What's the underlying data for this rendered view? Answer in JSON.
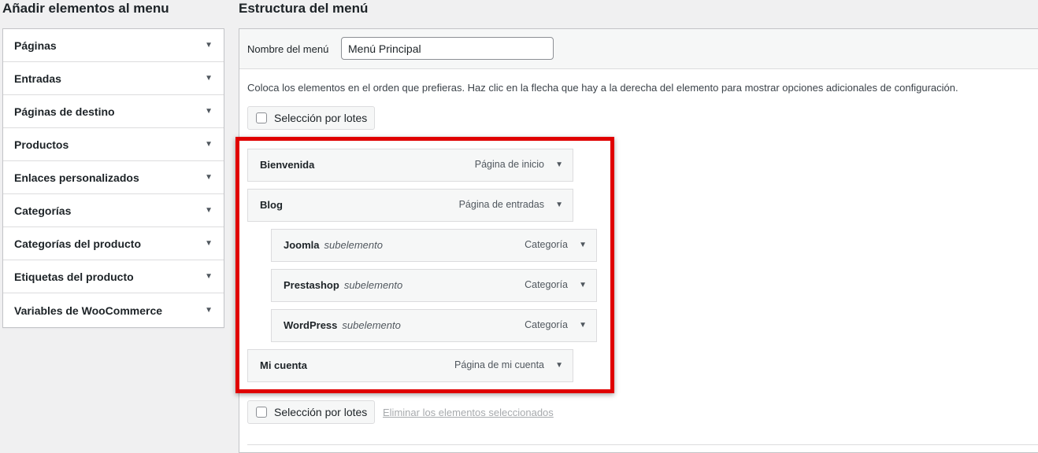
{
  "left_panel": {
    "title": "Añadir elementos al menu",
    "sections": [
      {
        "label": "Páginas"
      },
      {
        "label": "Entradas"
      },
      {
        "label": "Páginas de destino"
      },
      {
        "label": "Productos"
      },
      {
        "label": "Enlaces personalizados"
      },
      {
        "label": "Categorías"
      },
      {
        "label": "Categorías del producto"
      },
      {
        "label": "Etiquetas del producto"
      },
      {
        "label": "Variables de WooCommerce"
      }
    ]
  },
  "menu_structure": {
    "title": "Estructura del menú",
    "name_label": "Nombre del menú",
    "name_value": "Menú Principal",
    "instructions": "Coloca los elementos en el orden que prefieras. Haz clic en la flecha que hay a la derecha del elemento para mostrar opciones adicionales de configuración.",
    "bulk_select_label": "Selección por lotes",
    "delete_selected_label": "Eliminar los elementos seleccionados",
    "items": [
      {
        "title": "Bienvenida",
        "sub": "",
        "type": "Página de inicio",
        "depth": 0
      },
      {
        "title": "Blog",
        "sub": "",
        "type": "Página de entradas",
        "depth": 0
      },
      {
        "title": "Joomla",
        "sub": "subelemento",
        "type": "Categoría",
        "depth": 1
      },
      {
        "title": "Prestashop",
        "sub": "subelemento",
        "type": "Categoría",
        "depth": 1
      },
      {
        "title": "WordPress",
        "sub": "subelemento",
        "type": "Categoría",
        "depth": 1
      },
      {
        "title": "Mi cuenta",
        "sub": "",
        "type": "Página de mi cuenta",
        "depth": 0
      }
    ]
  },
  "icons": {
    "dropdown_caret": "▼"
  },
  "colors": {
    "highlight_frame": "#e00000",
    "link_disabled": "#a7aaad"
  }
}
